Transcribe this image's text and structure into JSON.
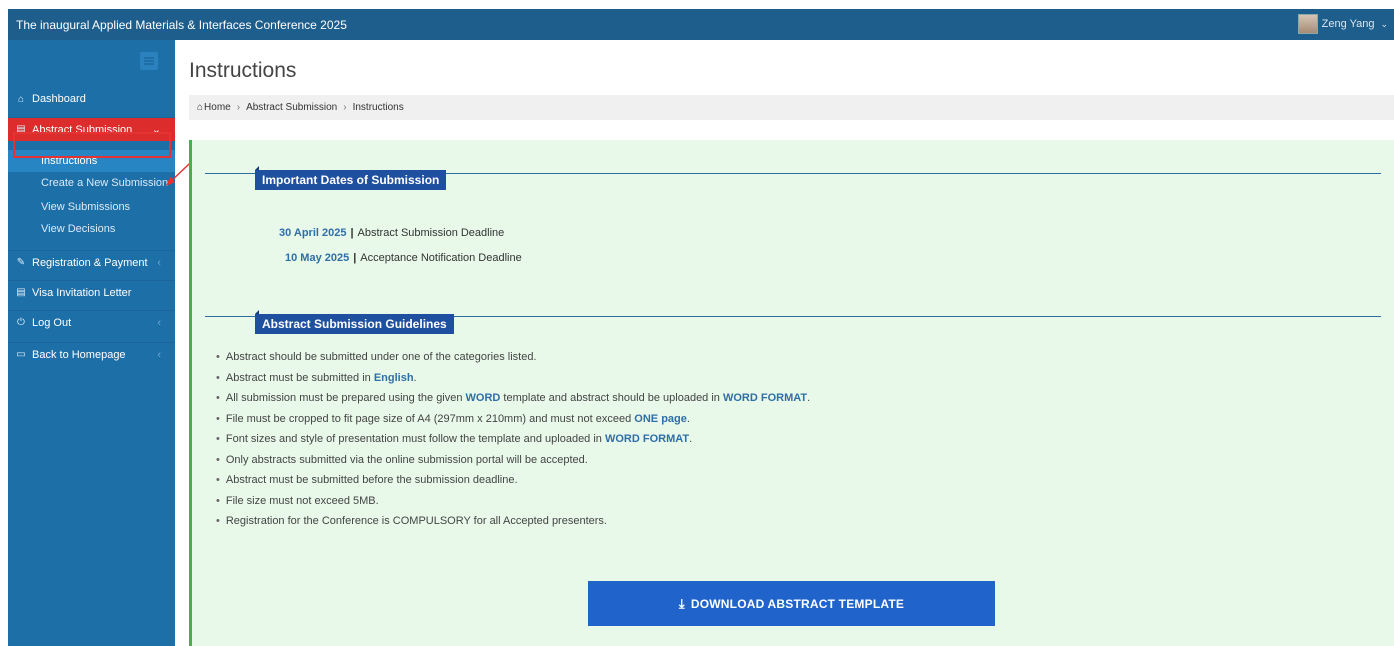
{
  "header": {
    "title": "The inaugural Applied Materials & Interfaces Conference 2025",
    "user_name": "Zeng Yang"
  },
  "sidebar": {
    "items": [
      {
        "label": "Dashboard",
        "icon": "home-icon"
      },
      {
        "label": "Abstract Submission",
        "icon": "document-icon",
        "active": true
      },
      {
        "label": "Registration & Payment",
        "icon": "edit-icon"
      },
      {
        "label": "Visa Invitation Letter",
        "icon": "document-icon"
      },
      {
        "label": "Log Out",
        "icon": "power-icon"
      },
      {
        "label": "Back to Homepage",
        "icon": "monitor-icon"
      }
    ],
    "submenu": [
      {
        "label": "Instructions"
      },
      {
        "label": "Create a New Submission"
      },
      {
        "label": "View Submissions"
      },
      {
        "label": "View Decisions"
      }
    ]
  },
  "main": {
    "page_title": "Instructions",
    "breadcrumb": [
      "Home",
      "Abstract Submission",
      "Instructions"
    ],
    "dates_section_title": "Important Dates of Submission",
    "dates": [
      {
        "date": "30 April 2025",
        "label": "Abstract Submission Deadline"
      },
      {
        "date": "10 May 2025",
        "label": "Acceptance Notification Deadline"
      }
    ],
    "guidelines_section_title": "Abstract Submission Guidelines",
    "guidelines": [
      {
        "pre": "Abstract should be submitted under one of the categories listed.",
        "b1": "",
        "mid": "",
        "b2": "",
        "post": ""
      },
      {
        "pre": "Abstract must be submitted in ",
        "b1": "English",
        "mid": ".",
        "b2": "",
        "post": ""
      },
      {
        "pre": "All submission must be prepared using the given ",
        "b1": "WORD",
        "mid": " template and abstract should be uploaded in ",
        "b2": "WORD FORMAT",
        "post": "."
      },
      {
        "pre": "File must be cropped to fit page size of A4 (297mm x 210mm) and must not exceed ",
        "b1": "ONE page",
        "mid": ".",
        "b2": "",
        "post": ""
      },
      {
        "pre": "Font sizes and style of presentation must follow the template and uploaded in ",
        "b1": "WORD FORMAT",
        "mid": ".",
        "b2": "",
        "post": ""
      },
      {
        "pre": "Only abstracts submitted via the online submission portal will be accepted.",
        "b1": "",
        "mid": "",
        "b2": "",
        "post": ""
      },
      {
        "pre": "Abstract must be submitted before the submission deadline.",
        "b1": "",
        "mid": "",
        "b2": "",
        "post": ""
      },
      {
        "pre": "File size must not exceed 5MB.",
        "b1": "",
        "mid": "",
        "b2": "",
        "post": ""
      },
      {
        "pre": "Registration for the Conference is COMPULSORY for all Accepted presenters.",
        "b1": "",
        "mid": "",
        "b2": "",
        "post": ""
      }
    ],
    "download_button": "DOWNLOAD ABSTRACT TEMPLATE"
  },
  "colors": {
    "header_bg": "#1d5e8c",
    "sidebar_bg": "#1d6fa8",
    "active_red": "#dd2c2c",
    "panel_bg": "#e8f8e9",
    "accent_green": "#45b14c",
    "section_tag": "#1f4f9f",
    "button_blue": "#2063cb",
    "link_blue": "#2f6fa8"
  }
}
